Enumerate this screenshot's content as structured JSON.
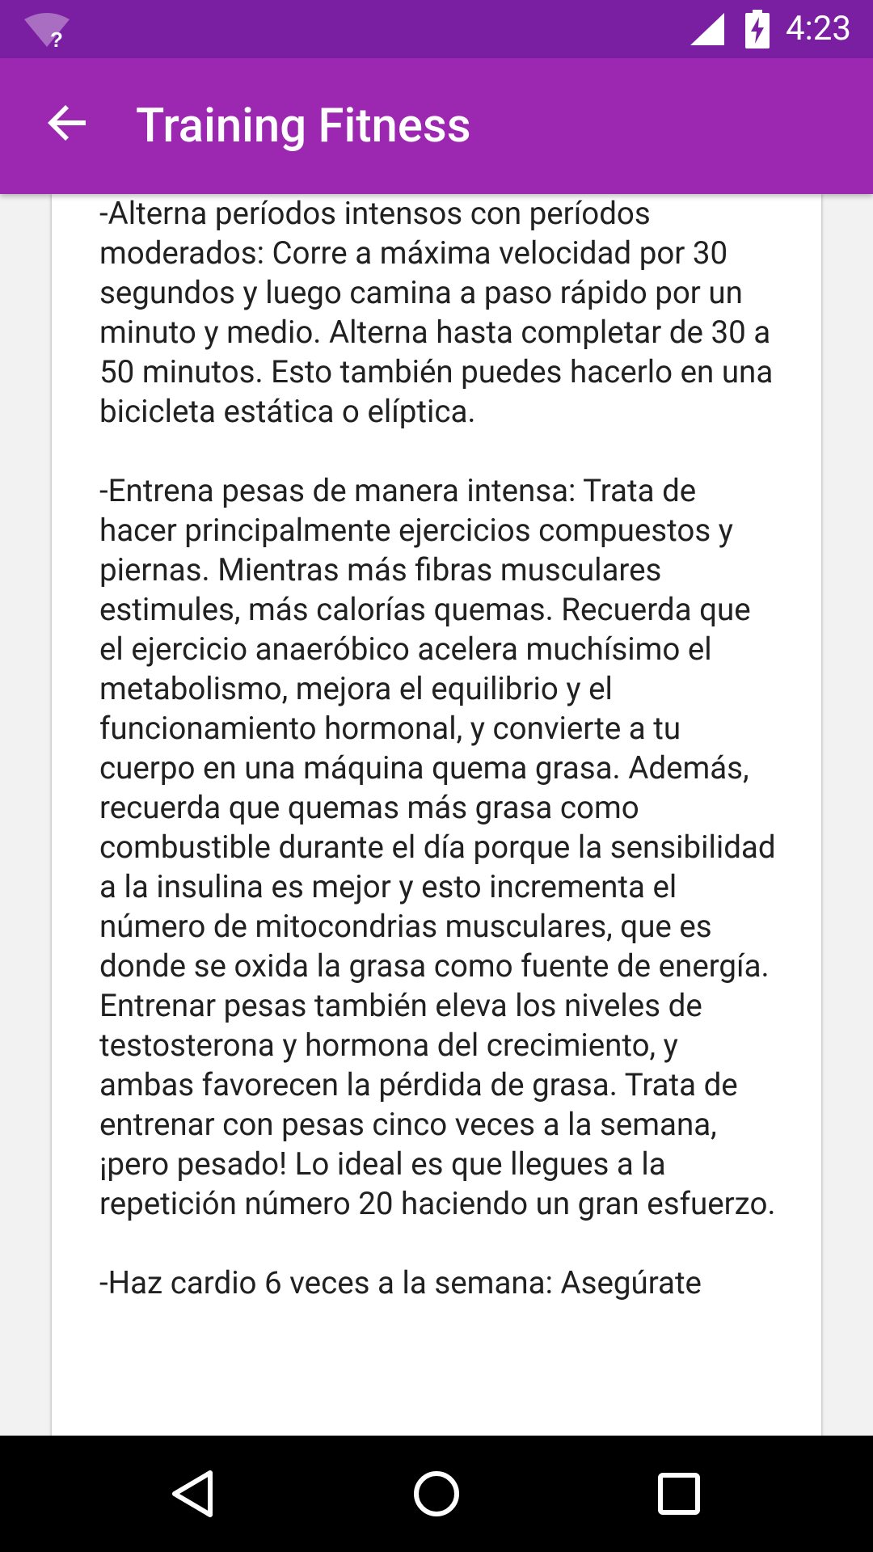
{
  "status_bar": {
    "time": "4:23",
    "icons": [
      "wifi-unknown-icon",
      "cell-signal-icon",
      "battery-charging-icon"
    ]
  },
  "app_bar": {
    "title": "Training Fitness",
    "back_icon": "arrow-back-icon"
  },
  "article": {
    "paragraph_1": "-Alterna períodos intensos con períodos moderados: Corre a máxima velocidad por 30 segundos y luego camina a paso rápido por un minuto y medio. Alterna hasta completar de 30 a 50 minutos. Esto también puedes hacerlo en una bicicleta estática o elíptica.",
    "paragraph_2": "-Entrena pesas de manera intensa: Trata de hacer principalmente ejercicios compuestos y piernas. Mientras más fibras musculares estimules, más calorías quemas. Recuerda que el ejercicio anaeróbico acelera muchísimo el metabolismo, mejora el equilibrio y el funcionamiento hormonal, y convierte a tu cuerpo en una máquina quema grasa. Además, recuerda que quemas más grasa como combustible durante el día porque la sensibilidad a la insulina es mejor y esto incrementa el número de mitocondrias musculares, que es donde se oxida la grasa como fuente de energía. Entrenar pesas también eleva los niveles de testosterona y hormona del crecimiento, y ambas favorecen la pérdida de grasa. Trata de entrenar con pesas cinco veces a la semana, ¡pero pesado! Lo ideal es que llegues a la repetición número 20 haciendo un gran esfuerzo.",
    "paragraph_3": "-Haz cardio 6 veces a la semana: Asegúrate"
  },
  "nav_bar": {
    "buttons": [
      "back-triangle-icon",
      "home-circle-icon",
      "recents-square-icon"
    ]
  },
  "colors": {
    "status_bar": "#7b1fa2",
    "app_bar": "#9c27b0",
    "nav_bar": "#000000",
    "card": "#ffffff",
    "text": "#212121"
  }
}
